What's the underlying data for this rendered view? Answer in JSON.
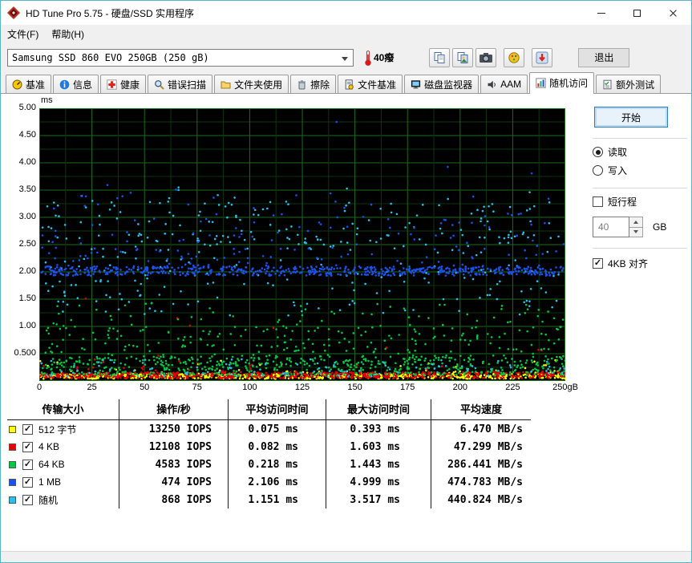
{
  "window": {
    "title": "HD Tune Pro 5.75 - 硬盘/SSD 实用程序"
  },
  "menu": {
    "items": [
      "文件(F)",
      "帮助(H)"
    ]
  },
  "toolbar": {
    "drive_select": "Samsung SSD 860 EVO 250GB (250 gB)",
    "temperature": "40癈",
    "exit_label": "退出"
  },
  "tabs": [
    {
      "id": "benchmark",
      "label": "基准",
      "icon": "gauge-icon",
      "selected": false
    },
    {
      "id": "info",
      "label": "信息",
      "icon": "info-icon",
      "selected": false
    },
    {
      "id": "health",
      "label": "健康",
      "icon": "health-icon",
      "selected": false
    },
    {
      "id": "error-scan",
      "label": "错误扫描",
      "icon": "scan-icon",
      "selected": false
    },
    {
      "id": "folder-usage",
      "label": "文件夹使用",
      "icon": "folder-icon",
      "selected": false
    },
    {
      "id": "erase",
      "label": "擦除",
      "icon": "erase-icon",
      "selected": false
    },
    {
      "id": "file-benchmark",
      "label": "文件基准",
      "icon": "file-benchmark-icon",
      "selected": false
    },
    {
      "id": "disk-monitor",
      "label": "磁盘监视器",
      "icon": "disk-monitor-icon",
      "selected": false
    },
    {
      "id": "aam",
      "label": "AAM",
      "icon": "aam-icon",
      "selected": false
    },
    {
      "id": "random-access",
      "label": "随机访问",
      "icon": "random-access-icon",
      "selected": true
    },
    {
      "id": "extra-tests",
      "label": "额外测试",
      "icon": "extra-tests-icon",
      "selected": false
    }
  ],
  "controls": {
    "start_label": "开始",
    "read_label": "读取",
    "read_selected": true,
    "write_label": "写入",
    "write_selected": false,
    "short_stroke_label": "短行程",
    "short_stroke_checked": false,
    "capacity_value": "40",
    "capacity_unit": "GB",
    "align_label": "4KB 对齐",
    "align_checked": true
  },
  "chart_data": {
    "type": "scatter",
    "ylabel": "ms",
    "x_range": [
      0,
      250
    ],
    "y_range": [
      0,
      5
    ],
    "grid": true,
    "y_ticks": [
      [
        5,
        "5.00"
      ],
      [
        4.5,
        "4.50"
      ],
      [
        4,
        "4.00"
      ],
      [
        3.5,
        "3.50"
      ],
      [
        3,
        "3.00"
      ],
      [
        2.5,
        "2.50"
      ],
      [
        2,
        "2.00"
      ],
      [
        1.5,
        "1.50"
      ],
      [
        1,
        "1.00"
      ],
      [
        0.5,
        "0.500"
      ]
    ],
    "x_ticks": [
      [
        0,
        "0"
      ],
      [
        25,
        "25"
      ],
      [
        50,
        "50"
      ],
      [
        75,
        "75"
      ],
      [
        100,
        "100"
      ],
      [
        125,
        "125"
      ],
      [
        150,
        "150"
      ],
      [
        175,
        "175"
      ],
      [
        200,
        "200"
      ],
      [
        225,
        "225"
      ],
      [
        250,
        "250gB"
      ]
    ],
    "series": [
      {
        "name": "512 字节",
        "color": "#ffff00",
        "avg_ms": 0.075,
        "max_ms": 0.393,
        "count": 650,
        "bands": [
          {
            "w": 0.9,
            "lo": 0.04,
            "hi": 0.13
          },
          {
            "w": 0.08,
            "lo": 0.1,
            "hi": 0.2
          },
          {
            "w": 0.02,
            "lo": 0.2,
            "hi": 0.39,
            "pow": 2
          }
        ]
      },
      {
        "name": "4 KB",
        "color": "#e60000",
        "avg_ms": 0.082,
        "max_ms": 1.603,
        "count": 650,
        "bands": [
          {
            "w": 0.88,
            "lo": 0.05,
            "hi": 0.16
          },
          {
            "w": 0.1,
            "lo": 0.12,
            "hi": 0.3,
            "pow": 2
          },
          {
            "w": 0.02,
            "lo": 0.3,
            "hi": 1.6,
            "pow": 2.5
          }
        ]
      },
      {
        "name": "64 KB",
        "color": "#00c846",
        "avg_ms": 0.218,
        "max_ms": 1.443,
        "count": 800,
        "bands": [
          {
            "w": 0.55,
            "lo": 0.1,
            "hi": 0.45,
            "pow": 1.3
          },
          {
            "w": 0.33,
            "lo": 0.3,
            "hi": 1.0,
            "pow": 1.4
          },
          {
            "w": 0.12,
            "lo": 0.9,
            "hi": 1.44
          }
        ]
      },
      {
        "name": "随机",
        "color": "#27c0ea",
        "avg_ms": 1.151,
        "max_ms": 3.517,
        "count": 450,
        "bands": [
          {
            "w": 0.25,
            "lo": 0.08,
            "hi": 0.4,
            "pow": 1.5
          },
          {
            "w": 0.45,
            "lo": 1.2,
            "hi": 2.7
          },
          {
            "w": 0.25,
            "lo": 2.5,
            "hi": 3.3
          },
          {
            "w": 0.05,
            "lo": 3.2,
            "hi": 3.55
          }
        ]
      },
      {
        "name": "1 MB",
        "color": "#1a52f0",
        "avg_ms": 2.106,
        "max_ms": 4.999,
        "count": 750,
        "bands": [
          {
            "w": 0.72,
            "lo": 1.93,
            "hi": 2.1
          },
          {
            "w": 0.2,
            "lo": 2.05,
            "hi": 3.1,
            "pow": 2
          },
          {
            "w": 0.07,
            "lo": 2.2,
            "hi": 3.4
          },
          {
            "w": 0.01,
            "lo": 3.4,
            "hi": 4.99,
            "pow": 2
          }
        ]
      }
    ]
  },
  "table": {
    "headers": [
      "传输大小",
      "操作/秒",
      "平均访问时间",
      "最大访问时间",
      "平均速度"
    ],
    "rows": [
      {
        "color": "#ffff00",
        "label": "512 字节",
        "checked": true,
        "iops": "13250 IOPS",
        "avg": "0.075 ms",
        "max": "0.393 ms",
        "speed": "6.470 MB/s"
      },
      {
        "color": "#e60000",
        "label": "4 KB",
        "checked": true,
        "iops": "12108 IOPS",
        "avg": "0.082 ms",
        "max": "1.603 ms",
        "speed": "47.299 MB/s"
      },
      {
        "color": "#00c846",
        "label": "64 KB",
        "checked": true,
        "iops": "4583 IOPS",
        "avg": "0.218 ms",
        "max": "1.443 ms",
        "speed": "286.441 MB/s"
      },
      {
        "color": "#1a52f0",
        "label": "1 MB",
        "checked": true,
        "iops": "474 IOPS",
        "avg": "2.106 ms",
        "max": "4.999 ms",
        "speed": "474.783 MB/s"
      },
      {
        "color": "#27c0ea",
        "label": "随机",
        "checked": true,
        "iops": "868 IOPS",
        "avg": "1.151 ms",
        "max": "3.517 ms",
        "speed": "440.824 MB/s"
      }
    ]
  }
}
